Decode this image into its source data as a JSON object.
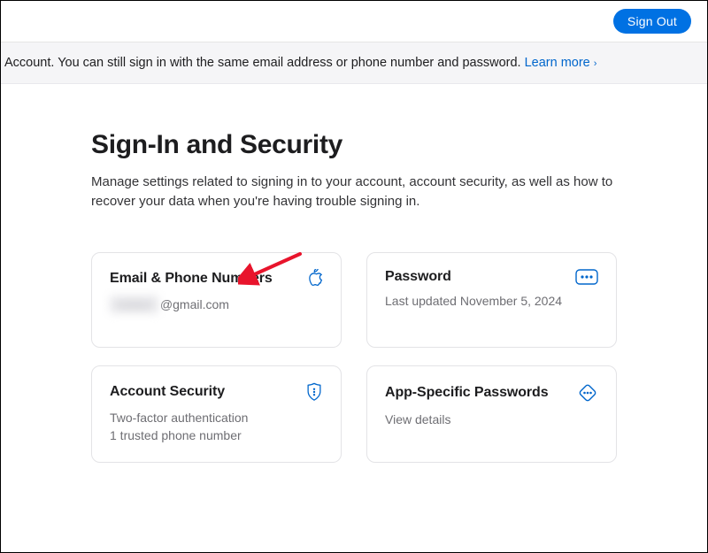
{
  "header": {
    "sign_out_label": "Sign Out"
  },
  "banner": {
    "text_prefix": "Account. You can still sign in with the same email address or phone number and password. ",
    "learn_more_label": "Learn more"
  },
  "page": {
    "title": "Sign-In and Security",
    "description": "Manage settings related to signing in to your account, account security, as well as how to recover your data when you're having trouble signing in."
  },
  "cards": {
    "email": {
      "title": "Email & Phone Numbers",
      "redacted_placeholder": "redact",
      "email_suffix": "@gmail.com",
      "icon": "apple-icon"
    },
    "password": {
      "title": "Password",
      "detail": "Last updated November 5, 2024",
      "icon": "dots-icon"
    },
    "account_security": {
      "title": "Account Security",
      "line1": "Two-factor authentication",
      "line2": "1 trusted phone number",
      "icon": "shield-icon"
    },
    "app_passwords": {
      "title": "App-Specific Passwords",
      "detail": "View details",
      "icon": "diamond-dots-icon"
    }
  }
}
